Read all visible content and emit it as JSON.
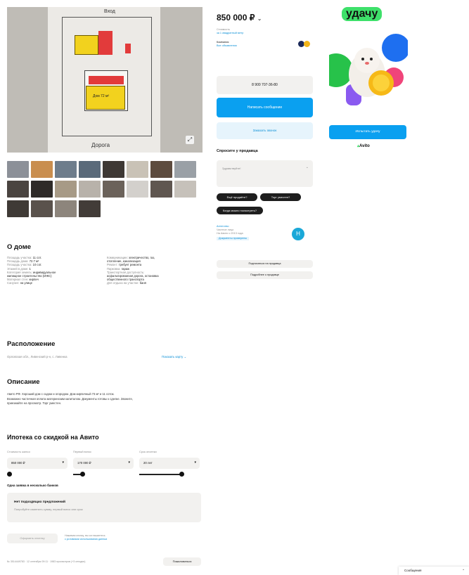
{
  "listing": {
    "price": "850 000 ₽",
    "price_caret": "⌄",
    "price_sub1": "Стоимость",
    "price_sub2": "за 1 квадратный метр",
    "seller_type": "Компания",
    "seller_link": "Все объявления"
  },
  "contact": {
    "phone": "8 900 707-36-80",
    "message_btn": "Написать сообщение",
    "call_btn": "Заказать звонок",
    "ask_title": "Спросите у продавца",
    "ask_placeholder": "Здравствуйте!",
    "quick_q": [
      "Ещё продаёте?",
      "Торг уместен?",
      "Когда можно посмотреть?"
    ],
    "agent_label": "Агентство",
    "agent_line1": "Частное лицо",
    "agent_line2": "На Авито с 2013 года",
    "agent_badge": "Документы проверены",
    "agent_initial": "Н",
    "subscribe_btn": "Подписаться на продавца",
    "more_btn": "Подробнее о продавце"
  },
  "ad": {
    "headline": "удачу",
    "cta": "Испытать удачу",
    "brand": "Avito"
  },
  "about": {
    "title": "О доме",
    "left": [
      {
        "k": "Площадь участка:",
        "v": "11 сот."
      },
      {
        "k": "Площадь дома:",
        "v": "72.7 м²"
      },
      {
        "k": "Площадь участка:",
        "v": "10 сот."
      },
      {
        "k": "Этажей в доме:",
        "v": "1"
      },
      {
        "k": "Категория земель:",
        "v": "индивидуальное"
      },
      {
        "k": "",
        "v": "жилищное строительство (ИЖС)"
      },
      {
        "k": "Материал стен:",
        "v": "кирпич"
      },
      {
        "k": "Санузел:",
        "v": "на улице"
      }
    ],
    "right": [
      {
        "k": "Коммуникации:",
        "v": "электричество, газ,"
      },
      {
        "k": "",
        "v": "отопление, канализация"
      },
      {
        "k": "Ремонт:",
        "v": "требует ремонта"
      },
      {
        "k": "Парковка:",
        "v": "гараж"
      },
      {
        "k": "Транспортная доступность:",
        "v": ""
      },
      {
        "k": "",
        "v": "асфальтированная дорога, остановка"
      },
      {
        "k": "",
        "v": "общественного транспорта"
      },
      {
        "k": "Для отдыха на участке:",
        "v": "баня"
      }
    ]
  },
  "location": {
    "title": "Расположение",
    "address": "Орловская обл., Ливенский р-н, с. Ливенка",
    "map_link": "Показать карту ⌄"
  },
  "description": {
    "title": "Описание",
    "lines": [
      "Авито РФ. Хороший дом с садом и огородом. Дом кирпичный 73 м² и 11 соток.",
      "Возможно частичная оплата материнским капиталом. Документы готовы к сделке. Звоните,",
      "приезжайте на просмотр. Торг уместен."
    ]
  },
  "mortgage": {
    "title": "Ипотека со скидкой на Авито",
    "fields": [
      {
        "label": "Стоимость жилья",
        "value": "850 000 ₽"
      },
      {
        "label": "Первый взнос",
        "value": "170 000 ₽"
      },
      {
        "label": "Срок ипотеки",
        "value": "20 лет"
      }
    ],
    "one_app": "Одна заявка в несколько банков",
    "empty_title": "Нет подходящих предложений",
    "empty_sub": "Попробуйте изменить сумму, первый взнос или срок",
    "apply_btn": "Оформить ипотеку",
    "apply_note1": "Нажимая кнопку, вы соглашаетесь",
    "apply_note2": "с условиями использования данных"
  },
  "footer": {
    "meta": "№ 3514449783 · 12 сентября 09:11 · 1983 просмотров (+3 сегодня)",
    "report_btn": "Пожаловаться"
  },
  "chat": {
    "label": "Сообщения",
    "caret": "⌃"
  },
  "plan": {
    "label_top": "Вход",
    "label_bottom": "Дорога",
    "label_room": "Дом 72 м²"
  }
}
